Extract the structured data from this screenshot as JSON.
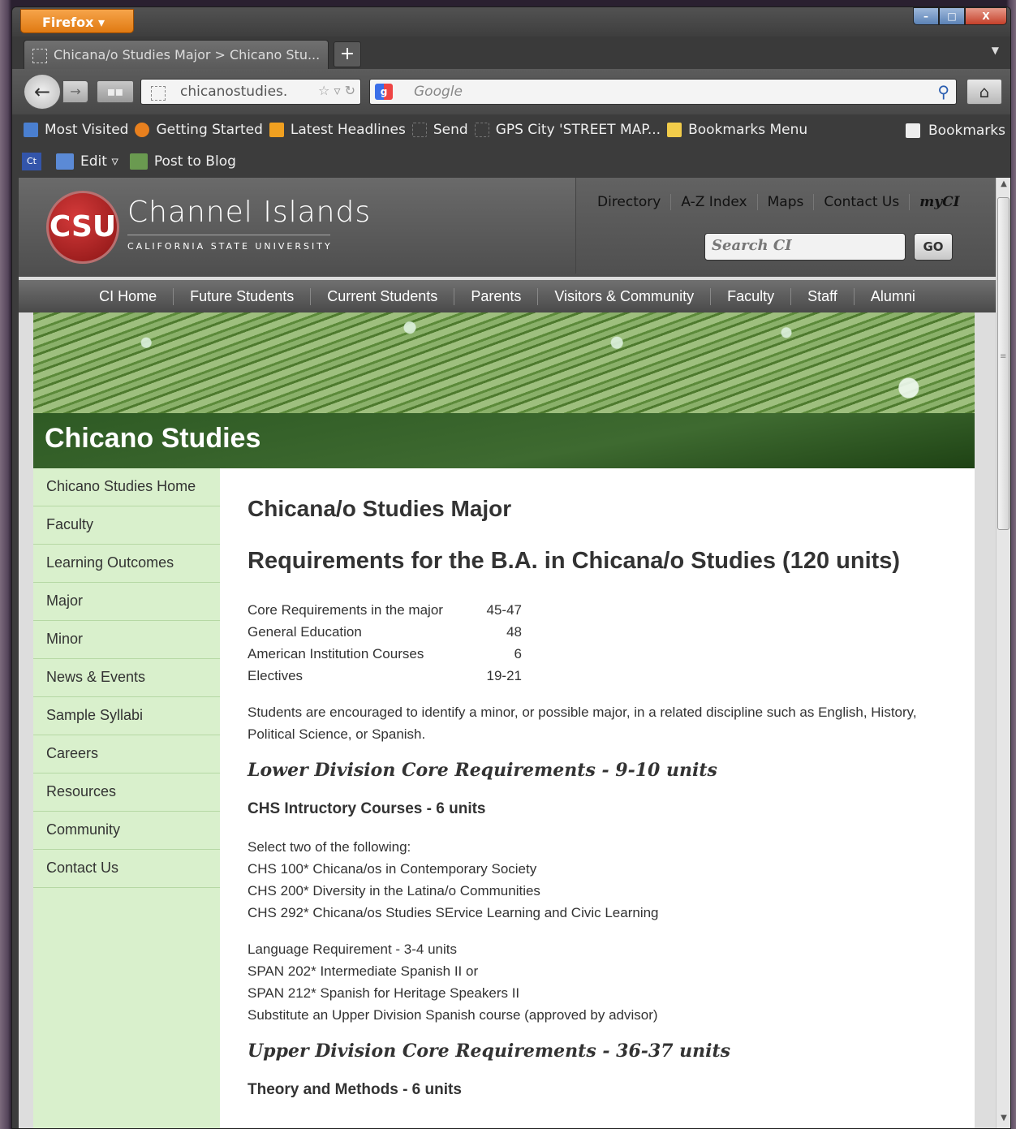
{
  "browser": {
    "menu_button": "Firefox",
    "window_controls": {
      "minimize": "–",
      "maximize": "□",
      "close": "X"
    },
    "tab_title": "Chicana/o Studies Major > Chicano Stu...",
    "new_tab": "+",
    "url_text": "chicanostudies.",
    "search_placeholder": "Google",
    "bookmarks": [
      "Most Visited",
      "Getting Started",
      "Latest Headlines",
      "Send",
      "GPS City 'STREET MAP...",
      "Bookmarks Menu"
    ],
    "bookmarks_button": "Bookmarks",
    "addon": {
      "ct": "Ct",
      "edit": "Edit",
      "post": "Post to Blog"
    }
  },
  "site": {
    "logo_text": "CSU",
    "brand": "Channel Islands",
    "brand_sub": "CALIFORNIA STATE UNIVERSITY",
    "util_links": [
      "Directory",
      "A-Z Index",
      "Maps",
      "Contact Us"
    ],
    "mycl": "myCI",
    "search_placeholder": "Search CI",
    "go": "GO",
    "main_nav": [
      "CI Home",
      "Future Students",
      "Current Students",
      "Parents",
      "Visitors & Community",
      "Faculty",
      "Staff",
      "Alumni"
    ],
    "section_title": "Chicano Studies",
    "sidebar": [
      "Chicano Studies Home",
      "Faculty",
      "Learning Outcomes",
      "Major",
      "Minor",
      "News & Events",
      "Sample Syllabi",
      "Careers",
      "Resources",
      "Community",
      "Contact Us"
    ]
  },
  "content": {
    "title": "Chicana/o Studies Major",
    "subtitle": "Requirements for the B.A. in Chicana/o Studies (120 units)",
    "units": [
      {
        "label": "Core Requirements in the major",
        "value": "45-47"
      },
      {
        "label": "General Education",
        "value": "48"
      },
      {
        "label": "American Institution Courses",
        "value": "6"
      },
      {
        "label": "Electives",
        "value": "19-21"
      }
    ],
    "encourage": "Students are encouraged to identify a minor, or possible major, in a related discipline such as English, History, Political Science, or Spanish.",
    "lower_heading": "Lower Division Core Requirements - 9-10 units",
    "chs_heading": "CHS Intructory Courses - 6 units",
    "chs_lines": [
      "Select two of the following:",
      "CHS 100* Chicana/os in Contemporary Society",
      "CHS 200* Diversity in the Latina/o Communities",
      "CHS 292* Chicana/os Studies SErvice Learning and Civic Learning"
    ],
    "lang_lines": [
      "Language Requirement - 3-4 units",
      "SPAN 202* Intermediate Spanish II or",
      "SPAN 212* Spanish for Heritage Speakers II",
      "Substitute an Upper Division Spanish course (approved by advisor)"
    ],
    "upper_heading": "Upper Division Core Requirements - 36-37 units",
    "theory_heading": "Theory and Methods - 6 units"
  }
}
